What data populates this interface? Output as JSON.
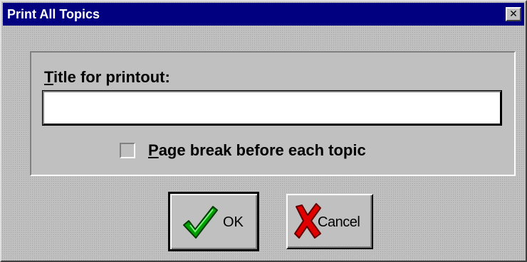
{
  "window": {
    "title": "Print All Topics",
    "close_glyph": "✕"
  },
  "form": {
    "title_label_accel": "T",
    "title_label_rest": "itle for printout:",
    "title_input_value": "",
    "page_break": {
      "accel": "P",
      "rest": "age break before each topic",
      "checked": false
    }
  },
  "buttons": {
    "ok_label": "OK",
    "ok_icon": "checkmark-icon",
    "ok_icon_color": "#00a000",
    "cancel_label": "Cancel",
    "cancel_icon": "x-mark-icon",
    "cancel_icon_color": "#e00000"
  },
  "colors": {
    "titlebar": "#000080",
    "face": "#c0c0c0"
  }
}
